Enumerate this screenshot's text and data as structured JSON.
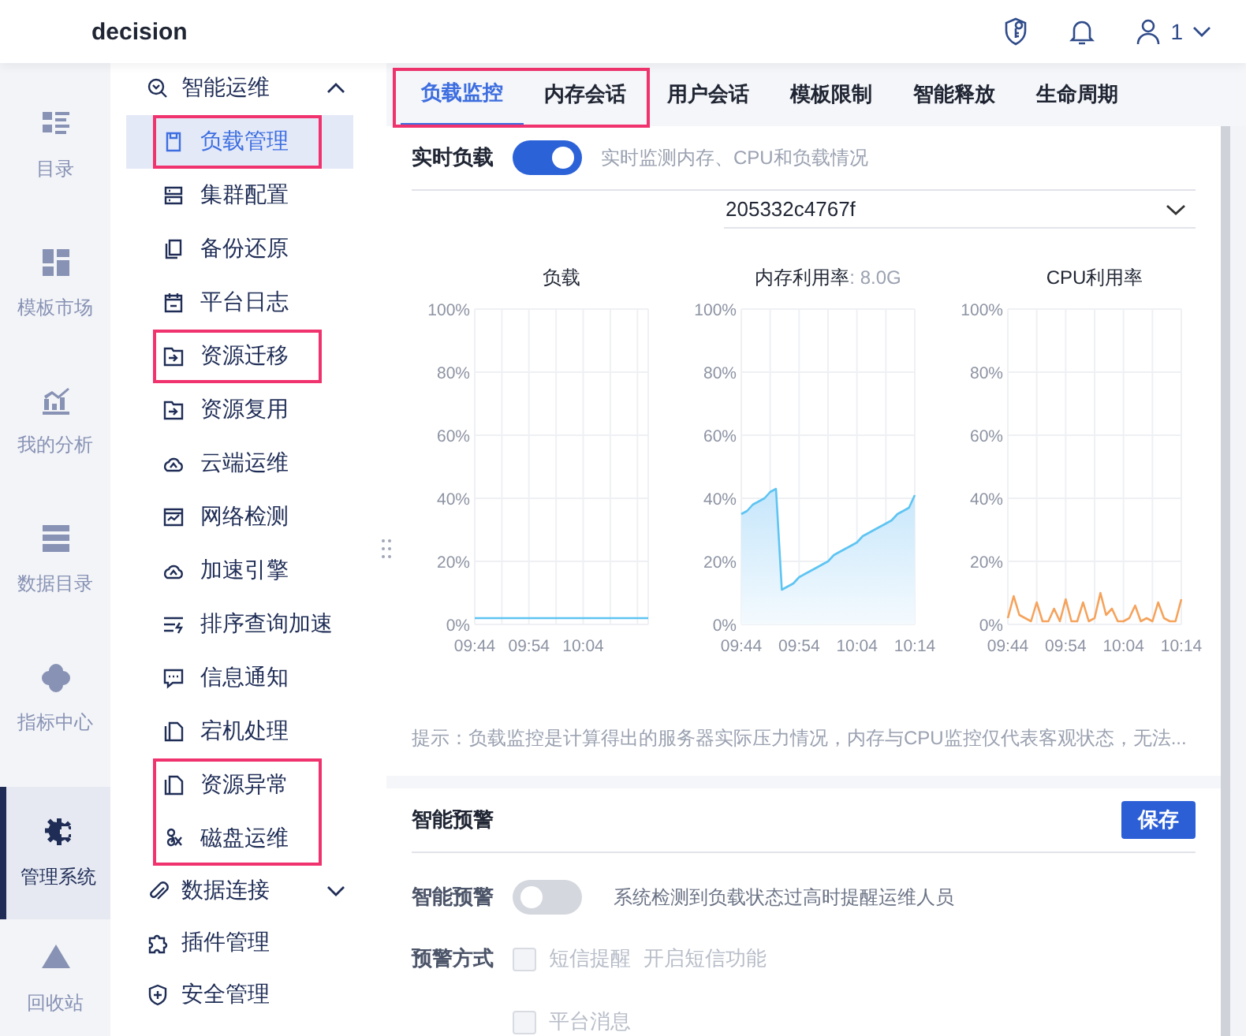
{
  "header": {
    "title": "decision",
    "user": "1"
  },
  "rail": [
    {
      "label": "目录",
      "selected": false
    },
    {
      "label": "模板市场",
      "selected": false
    },
    {
      "label": "我的分析",
      "selected": false
    },
    {
      "label": "数据目录",
      "selected": false
    },
    {
      "label": "指标中心",
      "selected": false
    },
    {
      "label": "管理系统",
      "selected": true
    },
    {
      "label": "回收站",
      "selected": false
    }
  ],
  "menu": [
    {
      "label": "智能运维",
      "expanded": true,
      "children": [
        {
          "label": "负载管理",
          "selected": true,
          "highlighted": true
        },
        {
          "label": "集群配置",
          "selected": false,
          "highlighted": false
        },
        {
          "label": "备份还原",
          "selected": false,
          "highlighted": false
        },
        {
          "label": "平台日志",
          "selected": false,
          "highlighted": false
        },
        {
          "label": "资源迁移",
          "selected": false,
          "highlighted": true
        },
        {
          "label": "资源复用",
          "selected": false,
          "highlighted": false
        },
        {
          "label": "云端运维",
          "selected": false,
          "highlighted": false
        },
        {
          "label": "网络检测",
          "selected": false,
          "highlighted": false
        },
        {
          "label": "加速引擎",
          "selected": false,
          "highlighted": false
        },
        {
          "label": "排序查询加速",
          "selected": false,
          "highlighted": false
        },
        {
          "label": "信息通知",
          "selected": false,
          "highlighted": false
        },
        {
          "label": "宕机处理",
          "selected": false,
          "highlighted": false
        },
        {
          "label": "资源异常",
          "selected": false,
          "highlighted": true
        },
        {
          "label": "磁盘运维",
          "selected": false,
          "highlighted": true
        }
      ]
    },
    {
      "label": "数据连接",
      "expanded": false
    },
    {
      "label": "插件管理"
    },
    {
      "label": "安全管理"
    }
  ],
  "tabs": [
    {
      "label": "负载监控",
      "selected": true,
      "highlighted": true
    },
    {
      "label": "内存会话",
      "selected": false,
      "highlighted": true
    },
    {
      "label": "用户会话",
      "selected": false,
      "highlighted": false
    },
    {
      "label": "模板限制",
      "selected": false,
      "highlighted": false
    },
    {
      "label": "智能释放",
      "selected": false,
      "highlighted": false
    },
    {
      "label": "生命周期",
      "selected": false,
      "highlighted": false
    }
  ],
  "realtime": {
    "label": "实时负载",
    "on": true,
    "description": "实时监测内存、CPU和负载情况"
  },
  "node_select": {
    "value": "205332c4767f"
  },
  "charts": [
    {
      "chart_data": {
        "type": "line",
        "title": "负载",
        "grid": true,
        "categories": [
          "09:44",
          null,
          null,
          null,
          null,
          null,
          null,
          null,
          null,
          null,
          "09:54",
          null,
          null,
          null,
          null,
          null,
          null,
          null,
          null,
          null,
          "10:04",
          null,
          null,
          null,
          null,
          null,
          null,
          null,
          null,
          null,
          null,
          null,
          null
        ],
        "series": [
          {
            "color": "#5ec4f2",
            "values": [
              2,
              2,
              2,
              2,
              2,
              2,
              2,
              2,
              2,
              2,
              2,
              2,
              2,
              2,
              2,
              2,
              2,
              2,
              2,
              2,
              2,
              2,
              2,
              2,
              2,
              2,
              2,
              2,
              2,
              2,
              2,
              2,
              2
            ]
          }
        ],
        "ylim": [
          0,
          100
        ],
        "yticks": [
          {
            "value": 0,
            "label": "0%"
          },
          {
            "value": 20,
            "label": "20%"
          },
          {
            "value": 40,
            "label": "40%"
          },
          {
            "value": 60,
            "label": "60%"
          },
          {
            "value": 80,
            "label": "80%"
          },
          {
            "value": 100,
            "label": "100%"
          }
        ]
      }
    },
    {
      "note": ": 8.0G",
      "chart_data": {
        "type": "area",
        "title": "内存利用率",
        "grid": true,
        "categories": [
          "09:44",
          null,
          null,
          null,
          null,
          null,
          null,
          null,
          null,
          null,
          "09:54",
          null,
          null,
          null,
          null,
          null,
          null,
          null,
          null,
          null,
          "10:04",
          null,
          null,
          null,
          null,
          null,
          null,
          null,
          null,
          null,
          "10:14"
        ],
        "series": [
          {
            "color": "#5ec4f2",
            "values": [
              35,
              36,
              38,
              39,
              40,
              42,
              43,
              11,
              12,
              13,
              15,
              16,
              17,
              18,
              19,
              20,
              22,
              23,
              24,
              25,
              26,
              28,
              29,
              30,
              31,
              32,
              33,
              35,
              36,
              37,
              41
            ]
          }
        ],
        "ylim": [
          0,
          100
        ],
        "yticks": [
          {
            "value": 0,
            "label": "0%"
          },
          {
            "value": 20,
            "label": "20%"
          },
          {
            "value": 40,
            "label": "40%"
          },
          {
            "value": 60,
            "label": "60%"
          },
          {
            "value": 80,
            "label": "80%"
          },
          {
            "value": 100,
            "label": "100%"
          }
        ]
      }
    },
    {
      "chart_data": {
        "type": "line",
        "title": "CPU利用率",
        "grid": true,
        "categories": [
          "09:44",
          null,
          null,
          null,
          null,
          null,
          null,
          null,
          null,
          null,
          "09:54",
          null,
          null,
          null,
          null,
          null,
          null,
          null,
          null,
          null,
          "10:04",
          null,
          null,
          null,
          null,
          null,
          null,
          null,
          null,
          null,
          "10:14"
        ],
        "series": [
          {
            "color": "#f5a35c",
            "values": [
              2,
              9,
              3,
              2,
              1,
              7,
              1,
              1,
              5,
              1,
              8,
              1,
              1,
              7,
              1,
              2,
              10,
              3,
              5,
              1,
              1,
              2,
              6,
              1,
              2,
              1,
              7,
              2,
              1,
              1,
              8
            ]
          }
        ],
        "ylim": [
          0,
          100
        ],
        "yticks": [
          {
            "value": 0,
            "label": "0%"
          },
          {
            "value": 20,
            "label": "20%"
          },
          {
            "value": 40,
            "label": "40%"
          },
          {
            "value": 60,
            "label": "60%"
          },
          {
            "value": 80,
            "label": "80%"
          },
          {
            "value": 100,
            "label": "100%"
          }
        ]
      }
    }
  ],
  "tip": "提示：负载监控是计算得出的服务器实际压力情况，内存与CPU监控仅代表客观状态，无法...",
  "alert": {
    "title": "智能预警",
    "save": "保存",
    "toggle_label": "智能预警",
    "on": false,
    "description": "系统检测到负载状态过高时提醒运维人员",
    "method_label": "预警方式",
    "options": [
      {
        "label": "短信提醒",
        "checked": false,
        "disabled": true,
        "note": "开启短信功能"
      },
      {
        "label": "平台消息",
        "checked": false,
        "disabled": true
      }
    ]
  }
}
